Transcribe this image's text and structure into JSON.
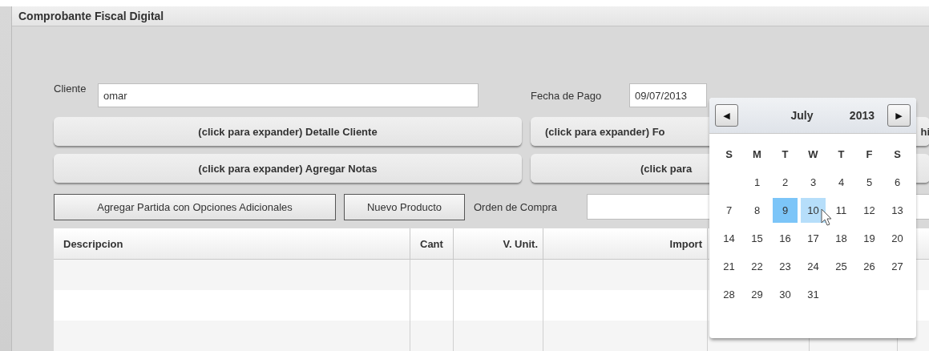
{
  "window": {
    "title": "Comprobante Fiscal Digital"
  },
  "cliente": {
    "label": "Cliente",
    "value": "omar"
  },
  "fecha_pago": {
    "label": "Fecha de Pago",
    "value": "09/07/2013"
  },
  "expander_left": [
    "(click para expander) Detalle Cliente",
    "(click para expander) Agregar Notas"
  ],
  "expander_right": [
    {
      "text": "(click para expander) Fo",
      "text_after": "hi"
    },
    {
      "text": "(click para"
    }
  ],
  "actions": [
    "Agregar Partida con Opciones Adicionales",
    "Nuevo Producto"
  ],
  "orden_compra": {
    "label": "Orden de Compra"
  },
  "table": {
    "columns": [
      "Descripcion",
      "Cant",
      "V. Unit.",
      "Import"
    ],
    "row_count_rows": [
      {
        "kind": "empty"
      },
      {
        "kind": "empty"
      },
      {
        "kind": "empty"
      }
    ]
  },
  "calendar": {
    "month": "July",
    "year": "2013",
    "prev": "◀",
    "next": "▶",
    "weekdays": [
      "S",
      "M",
      "T",
      "W",
      "T",
      "F",
      "S"
    ],
    "weeks": [
      [
        {
          "kind": "blank"
        },
        {
          "kind": "day",
          "label": "1",
          "selected": false,
          "hovered": false
        },
        {
          "kind": "day",
          "label": "2",
          "selected": false,
          "hovered": false
        },
        {
          "kind": "day",
          "label": "3",
          "selected": false,
          "hovered": false
        },
        {
          "kind": "day",
          "label": "4",
          "selected": false,
          "hovered": false
        },
        {
          "kind": "day",
          "label": "5",
          "selected": false,
          "hovered": false
        },
        {
          "kind": "day",
          "label": "6",
          "selected": false,
          "hovered": false
        }
      ],
      [
        {
          "kind": "day",
          "label": "7",
          "selected": false,
          "hovered": false
        },
        {
          "kind": "day",
          "label": "8",
          "selected": false,
          "hovered": false
        },
        {
          "kind": "day",
          "label": "9",
          "selected": true,
          "hovered": false
        },
        {
          "kind": "day",
          "label": "10",
          "selected": false,
          "hovered": true
        },
        {
          "kind": "day",
          "label": "11",
          "selected": false,
          "hovered": false
        },
        {
          "kind": "day",
          "label": "12",
          "selected": false,
          "hovered": false
        },
        {
          "kind": "day",
          "label": "13",
          "selected": false,
          "hovered": false
        }
      ],
      [
        {
          "kind": "day",
          "label": "14",
          "selected": false,
          "hovered": false
        },
        {
          "kind": "day",
          "label": "15",
          "selected": false,
          "hovered": false
        },
        {
          "kind": "day",
          "label": "16",
          "selected": false,
          "hovered": false
        },
        {
          "kind": "day",
          "label": "17",
          "selected": false,
          "hovered": false
        },
        {
          "kind": "day",
          "label": "18",
          "selected": false,
          "hovered": false
        },
        {
          "kind": "day",
          "label": "19",
          "selected": false,
          "hovered": false
        },
        {
          "kind": "day",
          "label": "20",
          "selected": false,
          "hovered": false
        }
      ],
      [
        {
          "kind": "day",
          "label": "21",
          "selected": false,
          "hovered": false
        },
        {
          "kind": "day",
          "label": "22",
          "selected": false,
          "hovered": false
        },
        {
          "kind": "day",
          "label": "23",
          "selected": false,
          "hovered": false
        },
        {
          "kind": "day",
          "label": "24",
          "selected": false,
          "hovered": false
        },
        {
          "kind": "day",
          "label": "25",
          "selected": false,
          "hovered": false
        },
        {
          "kind": "day",
          "label": "26",
          "selected": false,
          "hovered": false
        },
        {
          "kind": "day",
          "label": "27",
          "selected": false,
          "hovered": false
        }
      ],
      [
        {
          "kind": "day",
          "label": "28",
          "selected": false,
          "hovered": false
        },
        {
          "kind": "day",
          "label": "29",
          "selected": false,
          "hovered": false
        },
        {
          "kind": "day",
          "label": "30",
          "selected": false,
          "hovered": false
        },
        {
          "kind": "day",
          "label": "31",
          "selected": false,
          "hovered": false
        }
      ]
    ]
  }
}
